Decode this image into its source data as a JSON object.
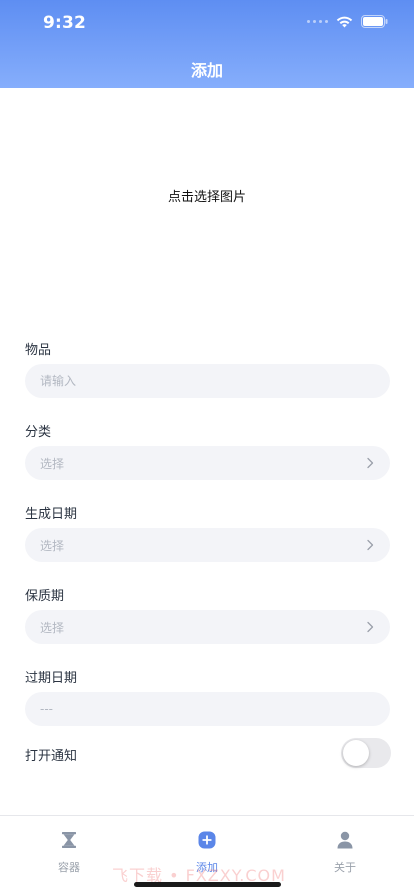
{
  "status_bar": {
    "time": "9:32"
  },
  "nav": {
    "title": "添加"
  },
  "image_picker": {
    "label": "点击选择图片"
  },
  "form": {
    "item": {
      "label": "物品",
      "placeholder": "请输入",
      "value": ""
    },
    "category": {
      "label": "分类",
      "placeholder": "选择"
    },
    "production_date": {
      "label": "生成日期",
      "placeholder": "选择"
    },
    "shelf_life": {
      "label": "保质期",
      "placeholder": "选择"
    },
    "expiry_date": {
      "label": "过期日期",
      "value": "---"
    },
    "notification": {
      "label": "打开通知",
      "enabled": false
    }
  },
  "tabbar": {
    "tabs": [
      {
        "label": "容器",
        "icon": "hourglass-icon",
        "active": false
      },
      {
        "label": "添加",
        "icon": "plus-circle-icon",
        "active": true
      },
      {
        "label": "关于",
        "icon": "user-icon",
        "active": false
      }
    ]
  },
  "watermark": {
    "text": "飞下载 • FXZXY.COM"
  },
  "colors": {
    "header_top": "#5e8ef2",
    "header_bottom": "#86aefc",
    "accent": "#5b86e8",
    "field_bg": "#f3f4f8",
    "placeholder": "#b3b8c2"
  }
}
